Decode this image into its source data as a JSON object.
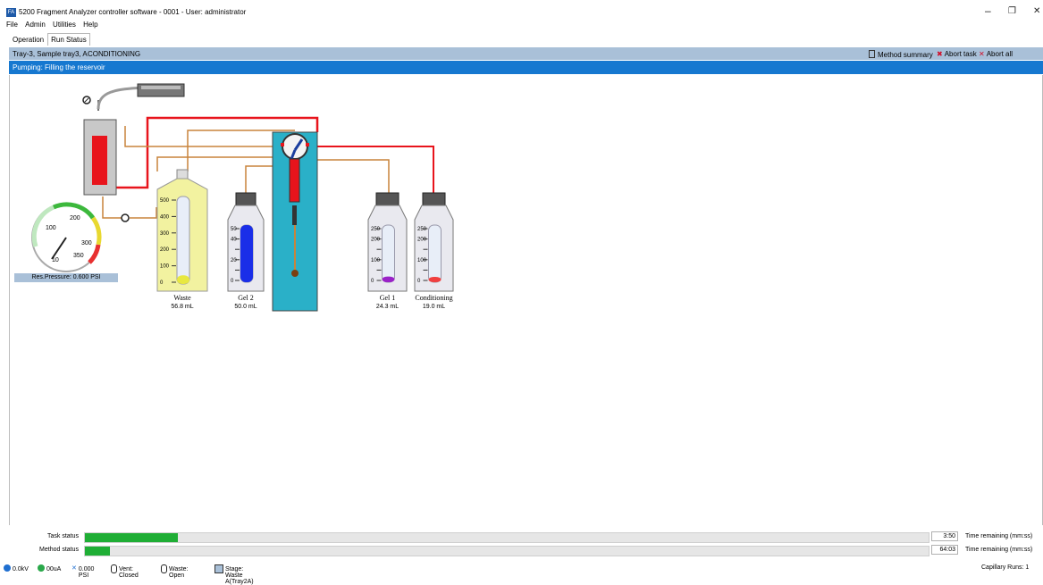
{
  "window": {
    "title": "5200 Fragment Analyzer controller software - 0001 - User: administrator",
    "app_icon_text": "FA",
    "minimize": "–",
    "restore": "❐",
    "close": "✕"
  },
  "menu": [
    "File",
    "Admin",
    "Utilities",
    "Help"
  ],
  "tabs": [
    {
      "label": "Operation",
      "active": false
    },
    {
      "label": "Run Status",
      "active": true
    }
  ],
  "run_header": {
    "sample": "Tray-3, Sample tray3, A",
    "state": "CONDITIONING",
    "method_summary": "Method summary",
    "abort_task": "Abort task",
    "abort_all": "Abort all"
  },
  "pump_status": "Pumping: Filling the reservoir",
  "gauge": {
    "ticks": [
      "100",
      "200",
      "300",
      "350",
      "10"
    ],
    "caption": "Res.Pressure: 0.600 PSI"
  },
  "bottles": [
    {
      "id": "waste",
      "label": "Waste",
      "volume": "56.8 mL",
      "fill_fraction": 0.1,
      "color": "#e8e840",
      "scale": [
        "500",
        "400",
        "300",
        "200",
        "100",
        "0"
      ]
    },
    {
      "id": "gel2",
      "label": "Gel 2",
      "volume": "50.0 mL",
      "fill_fraction": 1.0,
      "color": "#1a2ee8",
      "scale": [
        "50",
        "40",
        "",
        "20",
        "",
        "0"
      ]
    },
    {
      "id": "gel1",
      "label": "Gel 1",
      "volume": "24.3 mL",
      "fill_fraction": 0.1,
      "color": "#9a22c8",
      "scale": [
        "250",
        "200",
        "",
        "100",
        "",
        "0"
      ]
    },
    {
      "id": "conditioning",
      "label": "Conditioning",
      "volume": "19.0 mL",
      "fill_fraction": 0.08,
      "color": "#f04040",
      "scale": [
        "250",
        "200",
        "",
        "100",
        "",
        "0"
      ]
    }
  ],
  "progress": {
    "task": {
      "label": "Task status",
      "fraction": 0.11,
      "time": "3:50",
      "time_label": "Time remaining (mm:ss)"
    },
    "method": {
      "label": "Method status",
      "fraction": 0.03,
      "time": "64:03",
      "time_label": "Time remaining (mm:ss)"
    }
  },
  "footer": {
    "voltage": "0.0kV",
    "current": "00uA",
    "pressure": "0.000 PSI",
    "vent": "Vent: Closed",
    "waste": "Waste: Open",
    "stage": "Stage: Waste A(Tray2A)",
    "capillary": "Capillary Runs: 1"
  },
  "colors": {
    "header_blue": "#a9c0d8",
    "pump_blue": "#1678d0",
    "progress_green": "#1fae35",
    "tube_red": "#e8141c",
    "tube_brown": "#c8843c",
    "pump_teal": "#2ab0c8"
  }
}
